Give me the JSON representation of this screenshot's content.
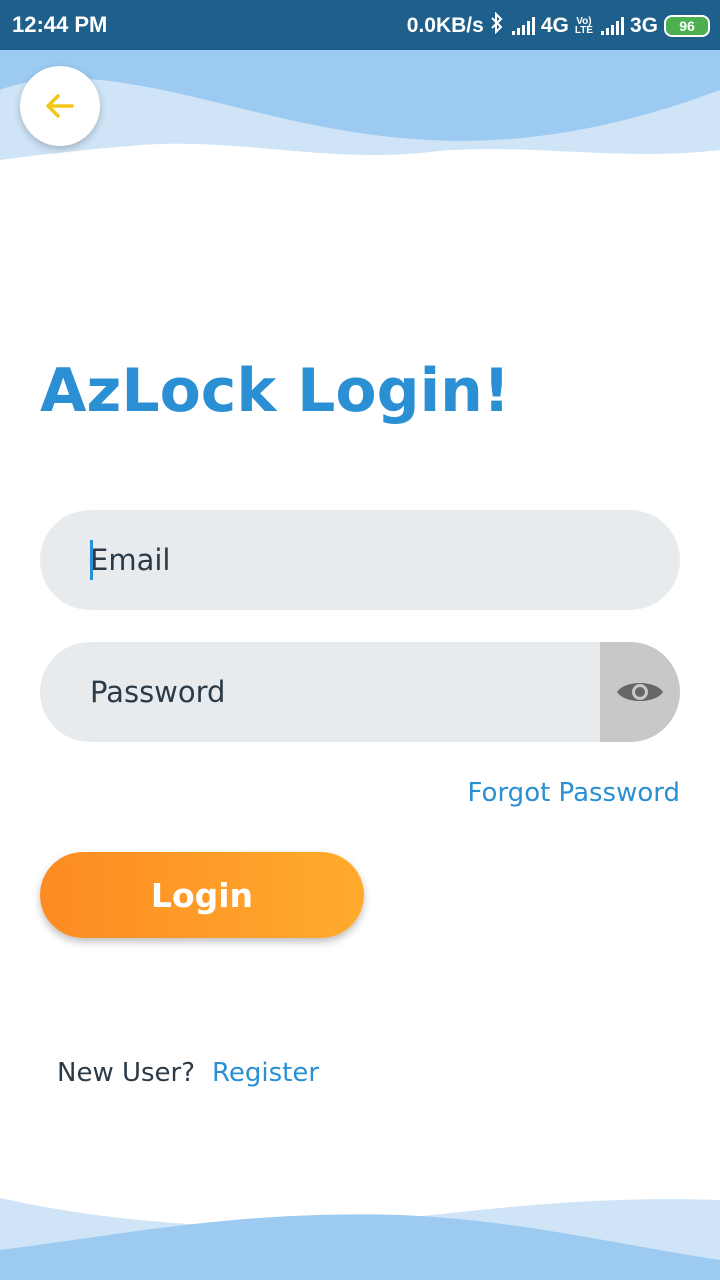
{
  "status_bar": {
    "time": "12:44 PM",
    "network_speed": "0.0KB/s",
    "network_1": "4G",
    "volte_line_1": "Vo)",
    "volte_line_2": "LTE",
    "network_2": "3G",
    "battery": "96"
  },
  "colors": {
    "accent": "#2b8fd4",
    "status_bar": "#1f5f8b",
    "back_arrow": "#f5c518",
    "login_gradient_start": "#fd8b22",
    "login_gradient_end": "#ffab2d",
    "field_background": "#e8ebed",
    "wave_light": "#cfe5f7",
    "wave_mid": "#9ccaf0"
  },
  "header": {
    "back_icon": "arrow-left-icon"
  },
  "main": {
    "title": "AzLock Login!",
    "email": {
      "placeholder": "Email",
      "value": ""
    },
    "password": {
      "placeholder": "Password",
      "value": "",
      "toggle_icon": "eye-icon"
    },
    "forgot_password_label": "Forgot Password",
    "login_label": "Login"
  },
  "footer": {
    "new_user_label": "New User?",
    "register_label": "Register"
  }
}
